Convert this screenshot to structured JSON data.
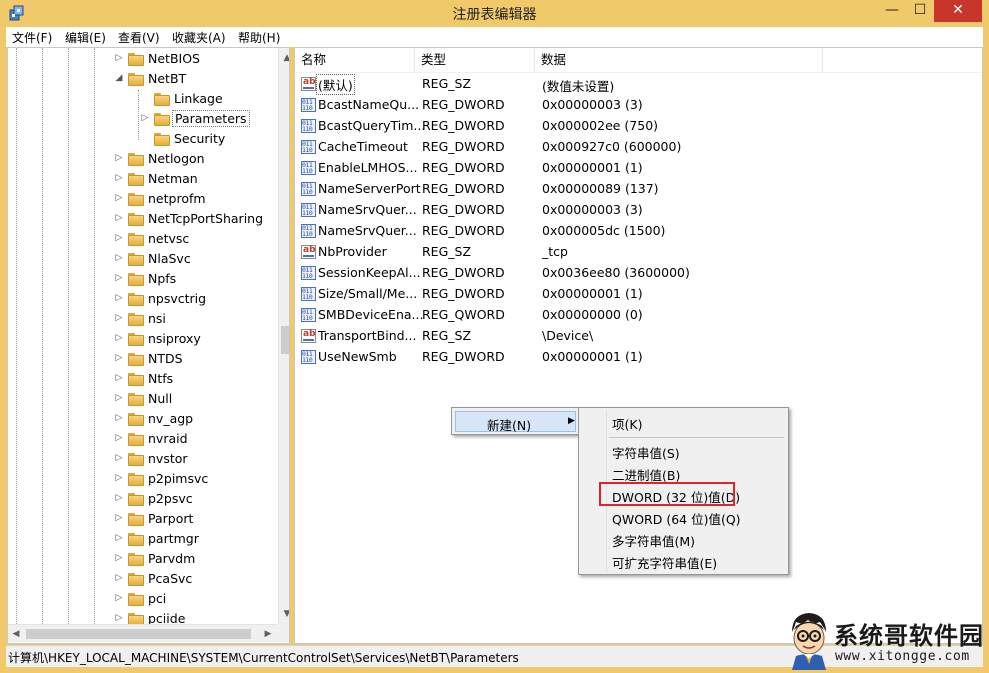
{
  "window": {
    "title": "注册表编辑器",
    "min_glyph": "—",
    "max_glyph": "☐",
    "close_glyph": "✕"
  },
  "menu": [
    "文件(F)",
    "编辑(E)",
    "查看(V)",
    "收藏夹(A)",
    "帮助(H)"
  ],
  "tree": {
    "items": [
      {
        "label": "NetBIOS",
        "depth": 0,
        "expander": "▷"
      },
      {
        "label": "NetBT",
        "depth": 0,
        "expander": "◢"
      },
      {
        "label": "Linkage",
        "depth": 1,
        "expander": ""
      },
      {
        "label": "Parameters",
        "depth": 1,
        "expander": "▷",
        "selected": true
      },
      {
        "label": "Security",
        "depth": 1,
        "expander": ""
      },
      {
        "label": "Netlogon",
        "depth": 0,
        "expander": "▷"
      },
      {
        "label": "Netman",
        "depth": 0,
        "expander": "▷"
      },
      {
        "label": "netprofm",
        "depth": 0,
        "expander": "▷"
      },
      {
        "label": "NetTcpPortSharing",
        "depth": 0,
        "expander": "▷"
      },
      {
        "label": "netvsc",
        "depth": 0,
        "expander": "▷"
      },
      {
        "label": "NlaSvc",
        "depth": 0,
        "expander": "▷"
      },
      {
        "label": "Npfs",
        "depth": 0,
        "expander": "▷"
      },
      {
        "label": "npsvctrig",
        "depth": 0,
        "expander": "▷"
      },
      {
        "label": "nsi",
        "depth": 0,
        "expander": "▷"
      },
      {
        "label": "nsiproxy",
        "depth": 0,
        "expander": "▷"
      },
      {
        "label": "NTDS",
        "depth": 0,
        "expander": "▷"
      },
      {
        "label": "Ntfs",
        "depth": 0,
        "expander": "▷"
      },
      {
        "label": "Null",
        "depth": 0,
        "expander": "▷"
      },
      {
        "label": "nv_agp",
        "depth": 0,
        "expander": "▷"
      },
      {
        "label": "nvraid",
        "depth": 0,
        "expander": "▷"
      },
      {
        "label": "nvstor",
        "depth": 0,
        "expander": "▷"
      },
      {
        "label": "p2pimsvc",
        "depth": 0,
        "expander": "▷"
      },
      {
        "label": "p2psvc",
        "depth": 0,
        "expander": "▷"
      },
      {
        "label": "Parport",
        "depth": 0,
        "expander": "▷"
      },
      {
        "label": "partmgr",
        "depth": 0,
        "expander": "▷"
      },
      {
        "label": "Parvdm",
        "depth": 0,
        "expander": "▷"
      },
      {
        "label": "PcaSvc",
        "depth": 0,
        "expander": "▷"
      },
      {
        "label": "pci",
        "depth": 0,
        "expander": "▷"
      },
      {
        "label": "pciide",
        "depth": 0,
        "expander": "▷"
      }
    ]
  },
  "list": {
    "columns": [
      "名称",
      "类型",
      "数据"
    ],
    "rows": [
      {
        "icon": "string-value-icon",
        "name": "(默认)",
        "type": "REG_SZ",
        "data": "(数值未设置)",
        "focused": true
      },
      {
        "icon": "binary-value-icon",
        "name": "BcastNameQu...",
        "type": "REG_DWORD",
        "data": "0x00000003 (3)"
      },
      {
        "icon": "binary-value-icon",
        "name": "BcastQueryTim...",
        "type": "REG_DWORD",
        "data": "0x000002ee (750)"
      },
      {
        "icon": "binary-value-icon",
        "name": "CacheTimeout",
        "type": "REG_DWORD",
        "data": "0x000927c0 (600000)"
      },
      {
        "icon": "binary-value-icon",
        "name": "EnableLMHOS...",
        "type": "REG_DWORD",
        "data": "0x00000001 (1)"
      },
      {
        "icon": "binary-value-icon",
        "name": "NameServerPort",
        "type": "REG_DWORD",
        "data": "0x00000089 (137)"
      },
      {
        "icon": "binary-value-icon",
        "name": "NameSrvQuer...",
        "type": "REG_DWORD",
        "data": "0x00000003 (3)"
      },
      {
        "icon": "binary-value-icon",
        "name": "NameSrvQuer...",
        "type": "REG_DWORD",
        "data": "0x000005dc (1500)"
      },
      {
        "icon": "string-value-icon",
        "name": "NbProvider",
        "type": "REG_SZ",
        "data": "_tcp"
      },
      {
        "icon": "binary-value-icon",
        "name": "SessionKeepAl...",
        "type": "REG_DWORD",
        "data": "0x0036ee80 (3600000)"
      },
      {
        "icon": "binary-value-icon",
        "name": "Size/Small/Me...",
        "type": "REG_DWORD",
        "data": "0x00000001 (1)"
      },
      {
        "icon": "binary-value-icon",
        "name": "SMBDeviceEna...",
        "type": "REG_QWORD",
        "data": "0x00000000 (0)"
      },
      {
        "icon": "string-value-icon",
        "name": "TransportBind...",
        "type": "REG_SZ",
        "data": "\\Device\\"
      },
      {
        "icon": "binary-value-icon",
        "name": "UseNewSmb",
        "type": "REG_DWORD",
        "data": "0x00000001 (1)"
      }
    ]
  },
  "context_menu": {
    "new_label": "新建(N)",
    "submenu_arrow": "▶",
    "submenu": [
      {
        "label": "项(K)",
        "group": 0
      },
      {
        "label": "字符串值(S)",
        "group": 1
      },
      {
        "label": "二进制值(B)",
        "group": 1
      },
      {
        "label": "DWORD (32 位)值(D)",
        "group": 1,
        "highlighted": true
      },
      {
        "label": "QWORD (64 位)值(Q)",
        "group": 1
      },
      {
        "label": "多字符串值(M)",
        "group": 1
      },
      {
        "label": "可扩充字符串值(E)",
        "group": 1
      }
    ]
  },
  "status_bar": {
    "path": "计算机\\HKEY_LOCAL_MACHINE\\SYSTEM\\CurrentControlSet\\Services\\NetBT\\Parameters"
  },
  "watermark": {
    "name": "系统哥软件园",
    "url": "www.xitongge.com"
  },
  "colors": {
    "title_bar": "#f0c96a",
    "close_button": "#c7352c",
    "menu_hover": "#d6e6f6",
    "highlight_box": "#d9262a",
    "folder": "#f2c24f"
  }
}
